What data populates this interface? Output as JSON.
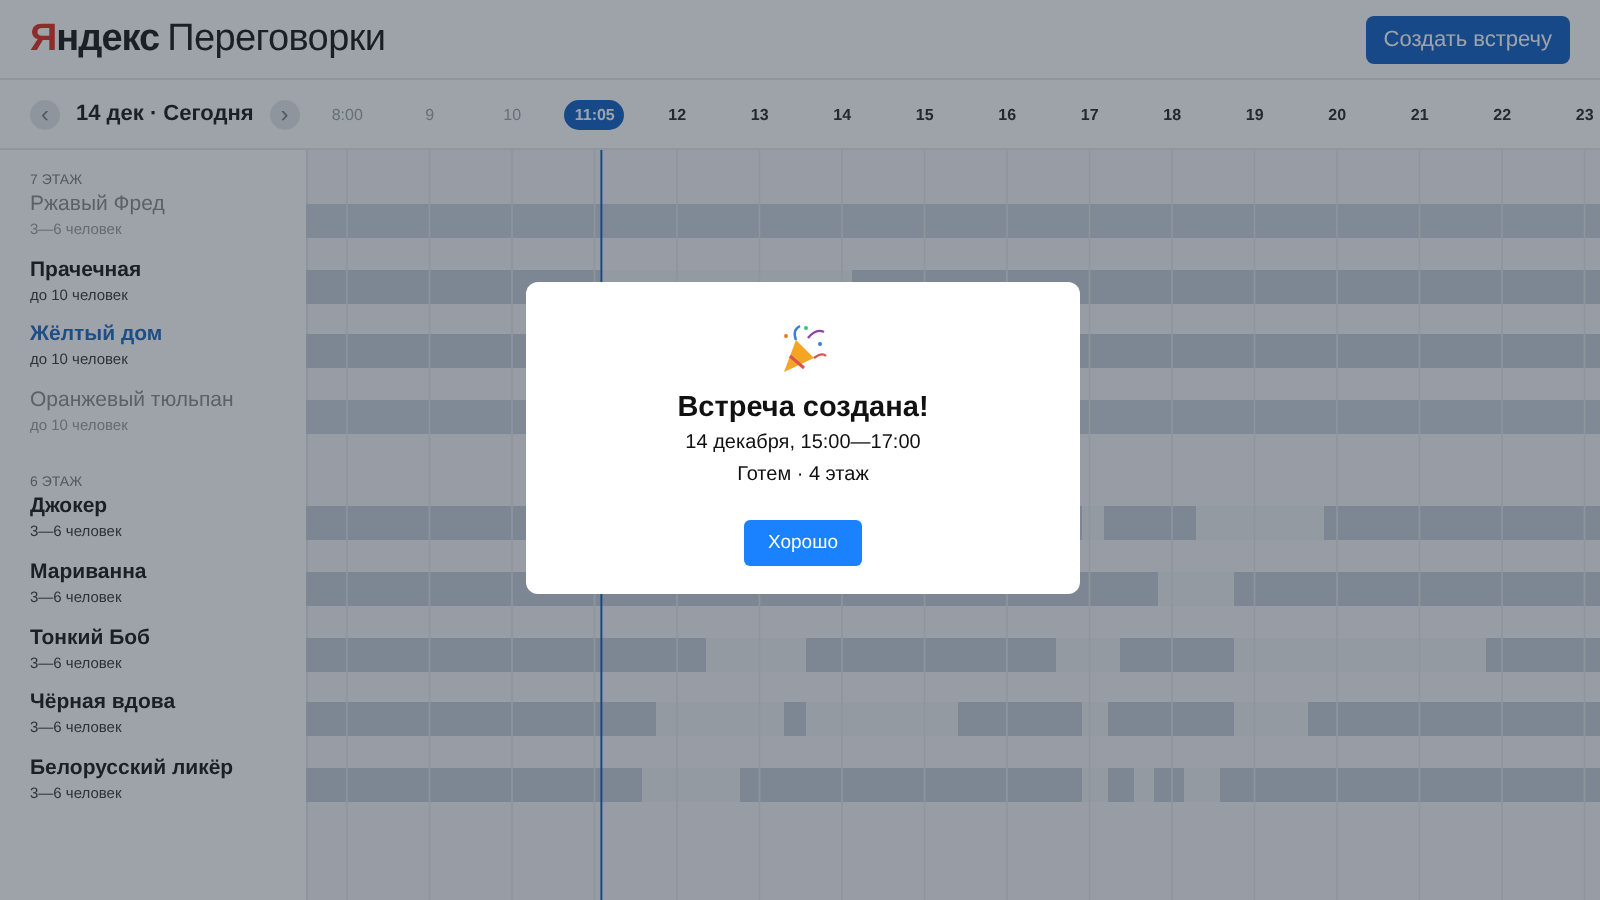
{
  "header": {
    "logo": {
      "brand": "Яндекс",
      "product": "Переговорки"
    },
    "create_button": "Создать встречу"
  },
  "timeline": {
    "prev": "‹",
    "date": "14 дек · Сегодня",
    "next": "›",
    "hours": [
      {
        "label": "8:00",
        "kind": "past"
      },
      {
        "label": "9",
        "kind": "past"
      },
      {
        "label": "10",
        "kind": "past"
      },
      {
        "label": "11:05",
        "kind": "now"
      },
      {
        "label": "12",
        "kind": "future"
      },
      {
        "label": "13",
        "kind": "future"
      },
      {
        "label": "14",
        "kind": "future"
      },
      {
        "label": "15",
        "kind": "future"
      },
      {
        "label": "16",
        "kind": "future"
      },
      {
        "label": "17",
        "kind": "future"
      },
      {
        "label": "18",
        "kind": "future"
      },
      {
        "label": "19",
        "kind": "future"
      },
      {
        "label": "20",
        "kind": "future"
      },
      {
        "label": "21",
        "kind": "future"
      },
      {
        "label": "22",
        "kind": "future"
      },
      {
        "label": "23",
        "kind": "future"
      }
    ]
  },
  "floors": [
    {
      "title": "7 ЭТАЖ",
      "rooms": [
        {
          "name": "Ржавый Фред",
          "capacity": "3—6 человек",
          "disabled": true,
          "selected": false
        },
        {
          "name": "Прачечная",
          "capacity": "до 10 человек",
          "disabled": false,
          "selected": false
        },
        {
          "name": "Жёлтый дом",
          "capacity": "до 10 человек",
          "disabled": false,
          "selected": true
        },
        {
          "name": "Оранжевый тюльпан",
          "capacity": "до 10 человек",
          "disabled": true,
          "selected": false
        }
      ]
    },
    {
      "title": "6 ЭТАЖ",
      "rooms": [
        {
          "name": "Джокер",
          "capacity": "3—6 человек",
          "disabled": false,
          "selected": false
        },
        {
          "name": "Мариванна",
          "capacity": "3—6 человек",
          "disabled": false,
          "selected": false
        },
        {
          "name": "Тонкий Боб",
          "capacity": "3—6 человек",
          "disabled": false,
          "selected": false
        },
        {
          "name": "Чёрная вдова",
          "capacity": "3—6 человек",
          "disabled": false,
          "selected": false
        },
        {
          "name": "Белорусский ликёр",
          "capacity": "3—6 человек",
          "disabled": false,
          "selected": false
        }
      ]
    }
  ],
  "modal": {
    "title": "Встреча создана!",
    "details": [
      "14 декабря, 15:00—17:00",
      "Готем · 4 этаж"
    ],
    "button": "Хорошо"
  }
}
